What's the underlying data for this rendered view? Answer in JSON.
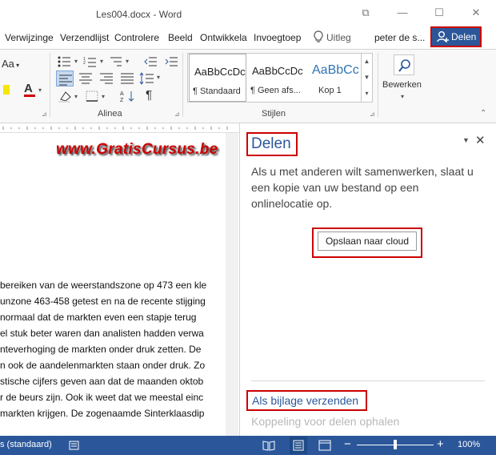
{
  "title_bar": {
    "doc_title": "Les004.docx - Word",
    "help": "?",
    "restore": "⧉",
    "minimize": "—",
    "maximize": "☐",
    "close": "✕"
  },
  "tabs": {
    "items": [
      {
        "label": "Verwijzinge"
      },
      {
        "label": "Verzendlijst"
      },
      {
        "label": "Controlere"
      },
      {
        "label": "Beeld"
      },
      {
        "label": "Ontwikkela"
      },
      {
        "label": "Invoegtoep"
      },
      {
        "label": "Uitleg"
      },
      {
        "label": "peter de s..."
      }
    ],
    "share_label": "Delen"
  },
  "ribbon": {
    "font_glyph": "Aa",
    "alinea_label": "Alinea",
    "stijlen_label": "Stijlen",
    "styles": [
      {
        "preview": "AaBbCcDc",
        "name": "¶ Standaard"
      },
      {
        "preview": "AaBbCcDc",
        "name": "¶ Geen afs..."
      },
      {
        "preview": "AaBbCc",
        "name": "Kop 1"
      }
    ],
    "bewerken_label": "Bewerken"
  },
  "document": {
    "watermark": "www.GratisCursus.be",
    "lines": [
      "bereiken van de weerstandszone op 473 een kle",
      "unzone 463-458 getest en na de recente stijging",
      "normaal dat de markten even een stapje terug",
      "el stuk beter waren dan analisten hadden verwa",
      "nteverhoging de markten onder druk zetten. De",
      "n ook de aandelenmarkten staan onder druk. Zo",
      "stische cijfers geven aan dat de maanden oktob",
      "r de beurs zijn. Ook ik weet dat we meestal einc",
      "markten krijgen. De zogenaamde Sinterklaasdip"
    ]
  },
  "share_pane": {
    "title": "Delen",
    "description": "Als u met anderen wilt samenwerken, slaat u een kopie van uw bestand op een onlinelocatie op.",
    "save_cloud_button": "Opslaan naar cloud",
    "send_attachment_link": "Als bijlage verzenden",
    "get_link_disabled": "Koppeling voor delen ophalen"
  },
  "status_bar": {
    "language": "s (standaard)",
    "zoom": "100%",
    "zoom_minus": "−",
    "zoom_plus": "+",
    "zoom_level": 1.0
  },
  "colors": {
    "accent": "#2b579a",
    "highlight": "#cc0000"
  }
}
